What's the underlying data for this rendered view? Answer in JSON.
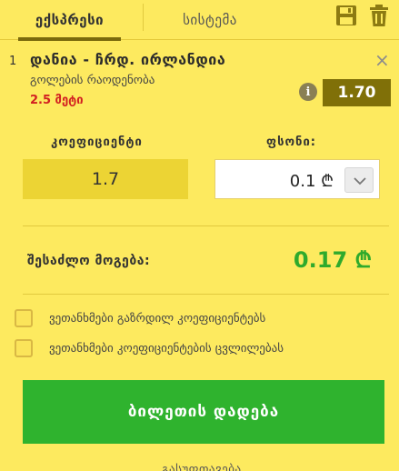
{
  "tabs": {
    "express": "ექსპრესი",
    "system": "სისტემა"
  },
  "bet": {
    "index": "1",
    "match": "დანია - ჩრდ. ირლანდია",
    "market": "გოლების რაოდენობა",
    "selection": "2.5 მეტი",
    "odds": "1.70",
    "info_glyph": "i",
    "close_glyph": "×"
  },
  "calculator": {
    "coef_label": "კოეფიციენტი",
    "coef_value": "1.7",
    "stake_label": "ფსონი:",
    "stake_value": "0.1 ₾",
    "win_label": "შესაძლო მოგება:",
    "win_value": "0.17 ₾"
  },
  "options": {
    "accept_higher": "ვეთანხმები გაზრდილ კოეფიციენტებს",
    "accept_changes": "ვეთანხმები კოეფიციენტების ცვლილებას"
  },
  "actions": {
    "place_bet": "ბილეთის დადება",
    "footer_link": "გასუფთავება"
  },
  "icons": {
    "save": "floppy-disk-icon",
    "trash": "trash-icon",
    "dropdown": "chevron-down-icon"
  },
  "colors": {
    "background": "#fdea5f",
    "odds_badge": "#807008",
    "win_value": "#2faa2c",
    "selection": "#d22121",
    "place_button": "#2fb32e"
  }
}
